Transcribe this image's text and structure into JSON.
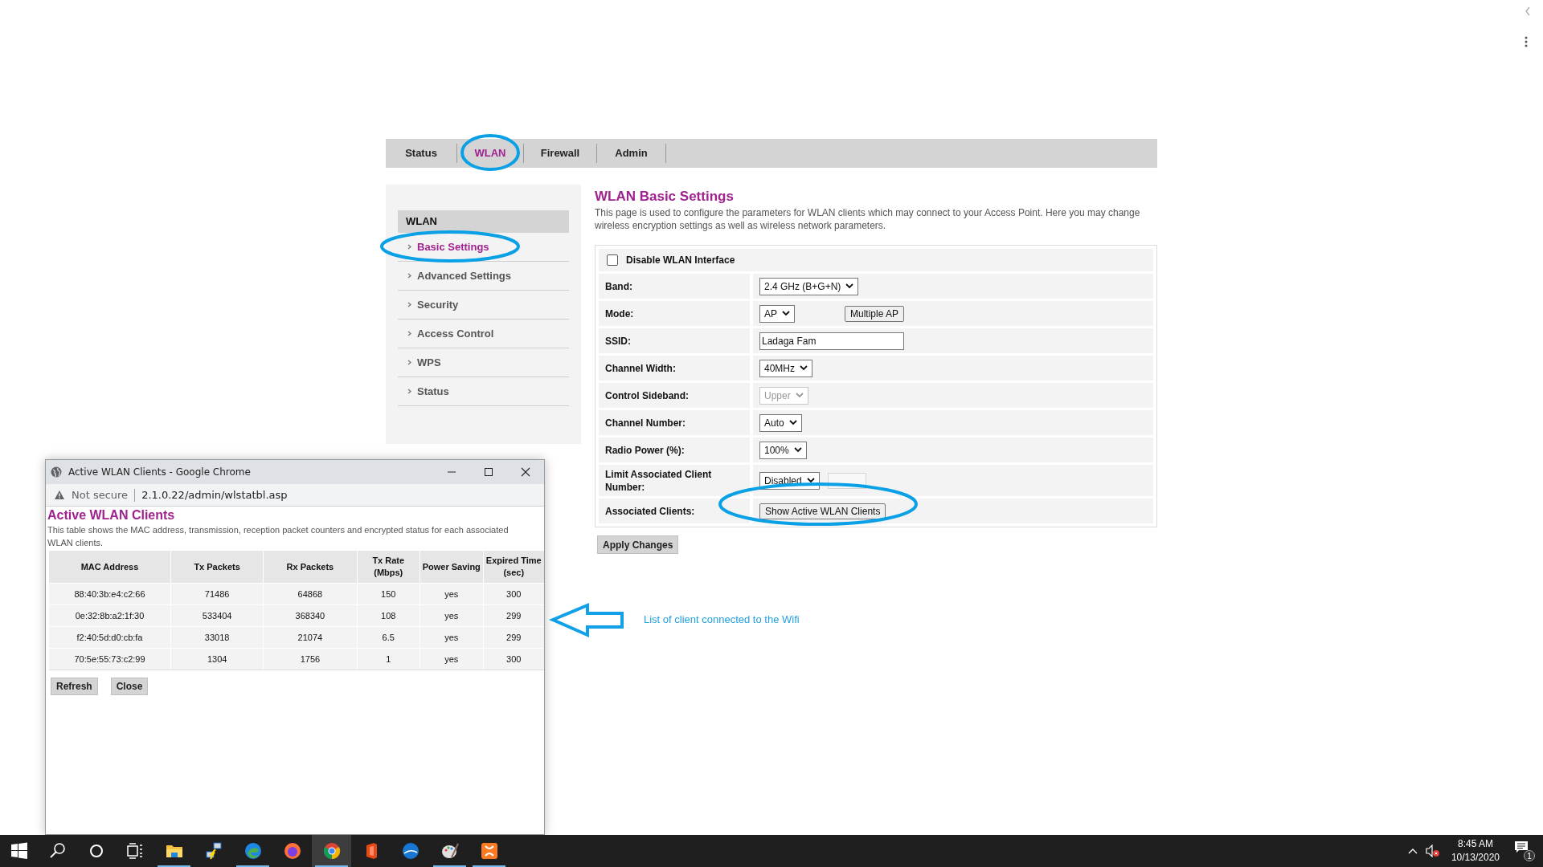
{
  "nav_tabs": [
    {
      "label": "Status",
      "selected": false
    },
    {
      "label": "WLAN",
      "selected": true
    },
    {
      "label": "Firewall",
      "selected": false
    },
    {
      "label": "Admin",
      "selected": false
    }
  ],
  "sidebar": {
    "header": "WLAN",
    "items": [
      {
        "label": "Basic Settings",
        "selected": true
      },
      {
        "label": "Advanced Settings",
        "selected": false
      },
      {
        "label": "Security",
        "selected": false
      },
      {
        "label": "Access Control",
        "selected": false
      },
      {
        "label": "WPS",
        "selected": false
      },
      {
        "label": "Status",
        "selected": false
      }
    ]
  },
  "main": {
    "title": "WLAN Basic Settings",
    "description": "This page is used to configure the parameters for WLAN clients which may connect to your Access Point. Here you may change wireless encryption settings as well as wireless network parameters.",
    "disable_wlan": {
      "label": "Disable WLAN Interface",
      "checked": false
    },
    "rows": [
      {
        "kind": "select",
        "label": "Band:",
        "value": "2.4 GHz (B+G+N)",
        "disabled": false
      },
      {
        "kind": "select_button",
        "label": "Mode:",
        "value": "AP",
        "button": "Multiple AP",
        "disabled": false
      },
      {
        "kind": "text",
        "label": "SSID:",
        "value": "Ladaga Fam",
        "disabled": false
      },
      {
        "kind": "select",
        "label": "Channel Width:",
        "value": "40MHz",
        "disabled": false
      },
      {
        "kind": "select",
        "label": "Control Sideband:",
        "value": "Upper",
        "disabled": true
      },
      {
        "kind": "select",
        "label": "Channel Number:",
        "value": "Auto",
        "disabled": false
      },
      {
        "kind": "select",
        "label": "Radio Power (%):",
        "value": "100%",
        "disabled": false
      },
      {
        "kind": "select_input",
        "label": "Limit Associated Client Number:",
        "value": "Disabled",
        "disabled": false
      },
      {
        "kind": "button",
        "label": "Associated Clients:",
        "button": "Show Active WLAN Clients",
        "disabled": false
      }
    ],
    "apply_button": "Apply Changes"
  },
  "popup": {
    "title": "Active WLAN Clients - Google Chrome",
    "security": "Not secure",
    "url": "2.1.0.22/admin/wlstatbl.asp",
    "heading": "Active WLAN Clients",
    "description": "This table shows the MAC address, transmission, reception packet counters and encrypted status for each associated WLAN clients.",
    "columns": [
      "MAC Address",
      "Tx Packets",
      "Rx Packets",
      "Tx Rate (Mbps)",
      "Power Saving",
      "Expired Time (sec)"
    ],
    "rows": [
      [
        "88:40:3b:e4:c2:66",
        "71486",
        "64868",
        "150",
        "yes",
        "300"
      ],
      [
        "0e:32:8b:a2:1f:30",
        "533404",
        "368340",
        "108",
        "yes",
        "299"
      ],
      [
        "f2:40:5d:d0:cb:fa",
        "33018",
        "21074",
        "6.5",
        "yes",
        "299"
      ],
      [
        "70:5e:55:73:c2:99",
        "1304",
        "1756",
        "1",
        "yes",
        "300"
      ]
    ],
    "buttons": [
      "Refresh",
      "Close"
    ]
  },
  "annotation": {
    "text": "List of client connected to the Wifi"
  },
  "taskbar": {
    "apps": [
      {
        "kind": "explorer",
        "running": true,
        "selected": false
      },
      {
        "kind": "network",
        "running": false,
        "selected": false
      },
      {
        "kind": "edge",
        "running": true,
        "selected": false
      },
      {
        "kind": "firefox",
        "running": false,
        "selected": false
      },
      {
        "kind": "chrome",
        "running": true,
        "selected": true
      },
      {
        "kind": "office",
        "running": false,
        "selected": false
      },
      {
        "kind": "globe",
        "running": false,
        "selected": false
      },
      {
        "kind": "paint",
        "running": true,
        "selected": false
      },
      {
        "kind": "xampp",
        "running": true,
        "selected": false
      }
    ],
    "time": "8:45 AM",
    "date": "10/13/2020",
    "notifications": "1"
  }
}
